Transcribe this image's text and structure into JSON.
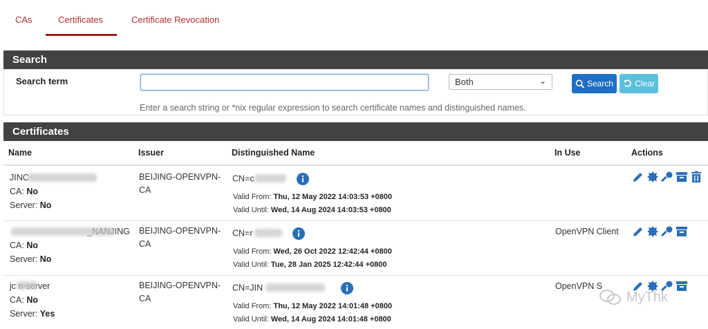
{
  "tabs": [
    {
      "label": "CAs",
      "active": false
    },
    {
      "label": "Certificates",
      "active": true
    },
    {
      "label": "Certificate Revocation",
      "active": false
    }
  ],
  "search": {
    "panel_title": "Search",
    "term_label": "Search term",
    "input_value": "",
    "scope_selected": "Both",
    "search_button": "Search",
    "clear_button": "Clear",
    "help": "Enter a search string or *nix regular expression to search certificate names and distinguished names."
  },
  "certificates": {
    "panel_title": "Certificates",
    "columns": [
      "Name",
      "Issuer",
      "Distinguished Name",
      "In Use",
      "Actions"
    ],
    "ca_label": "CA:",
    "server_label": "Server:",
    "valid_from_label": "Valid From:",
    "valid_until_label": "Valid Until:",
    "rows": [
      {
        "name": "JINC",
        "ca": "No",
        "server": "No",
        "issuer": "BEIJING-OPENVPN-CA",
        "dn": "CN=c",
        "valid_from": "Thu, 12 May 2022 14:03:53 +0800",
        "valid_until": "Wed, 14 Aug 2024 14:03:53 +0800",
        "in_use": ""
      },
      {
        "name": "_NANJING",
        "ca": "No",
        "server": "No",
        "issuer": "BEIJING-OPENVPN-CA",
        "dn": "CN=r",
        "valid_from": "Wed, 26 Oct 2022 12:42:44 +0800",
        "valid_until": "Tue, 28 Jan 2025 12:42:44 +0800",
        "in_use": "OpenVPN Client"
      },
      {
        "name": "jc    n-server",
        "ca": "No",
        "server": "Yes",
        "issuer": "BEIJING-OPENVPN-CA",
        "dn": "CN=JIN",
        "valid_from": "Thu, 12 May 2022 14:01:48 +0800",
        "valid_until": "Wed, 14 Aug 2024 14:01:48 +0800",
        "in_use": "OpenVPN S"
      }
    ]
  },
  "watermark": "MyThk",
  "colors": {
    "accent": "#a11d1d",
    "header": "#424242",
    "primary": "#1e6fc4",
    "info": "#5bc0de",
    "icon": "#1e6fc4"
  }
}
